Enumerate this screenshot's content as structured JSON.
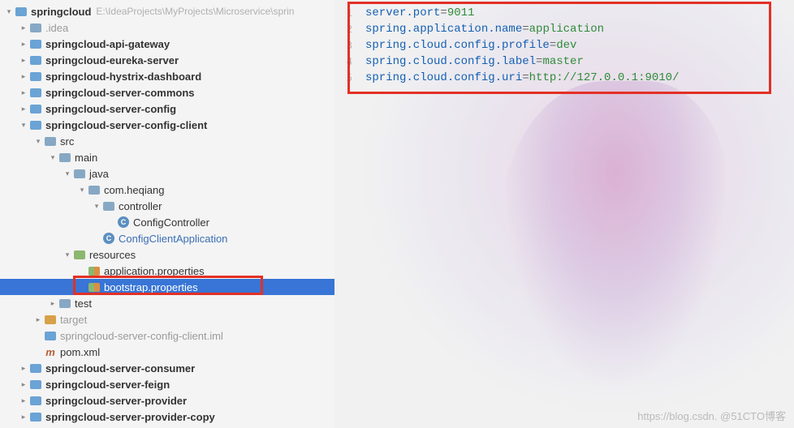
{
  "project": {
    "name": "springcloud",
    "path": "E:\\IdeaProjects\\MyProjects\\Microservice\\sprin"
  },
  "tree": [
    {
      "depth": 0,
      "arrow": "down",
      "icon": "module",
      "label": "springcloud",
      "bold": true,
      "path": true
    },
    {
      "depth": 1,
      "arrow": "right",
      "icon": "folder",
      "label": ".idea",
      "gray": true
    },
    {
      "depth": 1,
      "arrow": "right",
      "icon": "module",
      "label": "springcloud-api-gateway",
      "bold": true
    },
    {
      "depth": 1,
      "arrow": "right",
      "icon": "module",
      "label": "springcloud-eureka-server",
      "bold": true
    },
    {
      "depth": 1,
      "arrow": "right",
      "icon": "module",
      "label": "springcloud-hystrix-dashboard",
      "bold": true
    },
    {
      "depth": 1,
      "arrow": "right",
      "icon": "module",
      "label": "springcloud-server-commons",
      "bold": true
    },
    {
      "depth": 1,
      "arrow": "right",
      "icon": "module",
      "label": "springcloud-server-config",
      "bold": true
    },
    {
      "depth": 1,
      "arrow": "down",
      "icon": "module",
      "label": "springcloud-server-config-client",
      "bold": true
    },
    {
      "depth": 2,
      "arrow": "down",
      "icon": "folder",
      "label": "src"
    },
    {
      "depth": 3,
      "arrow": "down",
      "icon": "folder",
      "label": "main"
    },
    {
      "depth": 4,
      "arrow": "down",
      "icon": "folder",
      "label": "java"
    },
    {
      "depth": 5,
      "arrow": "down",
      "icon": "folder",
      "label": "com.heqiang"
    },
    {
      "depth": 6,
      "arrow": "down",
      "icon": "folder",
      "label": "controller"
    },
    {
      "depth": 7,
      "arrow": "",
      "icon": "class",
      "label": "ConfigController"
    },
    {
      "depth": 6,
      "arrow": "",
      "icon": "class",
      "label": "ConfigClientApplication",
      "blue": true
    },
    {
      "depth": 4,
      "arrow": "down",
      "icon": "resources",
      "label": "resources"
    },
    {
      "depth": 5,
      "arrow": "",
      "icon": "props",
      "label": "application.properties"
    },
    {
      "depth": 5,
      "arrow": "",
      "icon": "props",
      "label": "bootstrap.properties",
      "selected": true
    },
    {
      "depth": 3,
      "arrow": "right",
      "icon": "folder",
      "label": "test"
    },
    {
      "depth": 2,
      "arrow": "right",
      "icon": "folder-orange",
      "label": "target",
      "gray": true
    },
    {
      "depth": 2,
      "arrow": "",
      "icon": "iml",
      "label": "springcloud-server-config-client.iml",
      "gray": true
    },
    {
      "depth": 2,
      "arrow": "",
      "icon": "maven",
      "label": "pom.xml"
    },
    {
      "depth": 1,
      "arrow": "right",
      "icon": "module",
      "label": "springcloud-server-consumer",
      "bold": true
    },
    {
      "depth": 1,
      "arrow": "right",
      "icon": "module",
      "label": "springcloud-server-feign",
      "bold": true
    },
    {
      "depth": 1,
      "arrow": "right",
      "icon": "module",
      "label": "springcloud-server-provider",
      "bold": true
    },
    {
      "depth": 1,
      "arrow": "right",
      "icon": "module",
      "label": "springcloud-server-provider-copy",
      "bold": true
    }
  ],
  "gutter": [
    "1",
    "2",
    "3",
    "4",
    "5"
  ],
  "code": [
    {
      "key": "server.port",
      "val": "9011"
    },
    {
      "key": "spring.application.name",
      "val": "application"
    },
    {
      "key": "spring.cloud.config.profile",
      "val": "dev"
    },
    {
      "key": "spring.cloud.config.label",
      "val": "master"
    },
    {
      "key": "spring.cloud.config.uri",
      "val": "http://127.0.0.1:9010/"
    }
  ],
  "watermark": "https://blog.csdn. @51CTO博客"
}
